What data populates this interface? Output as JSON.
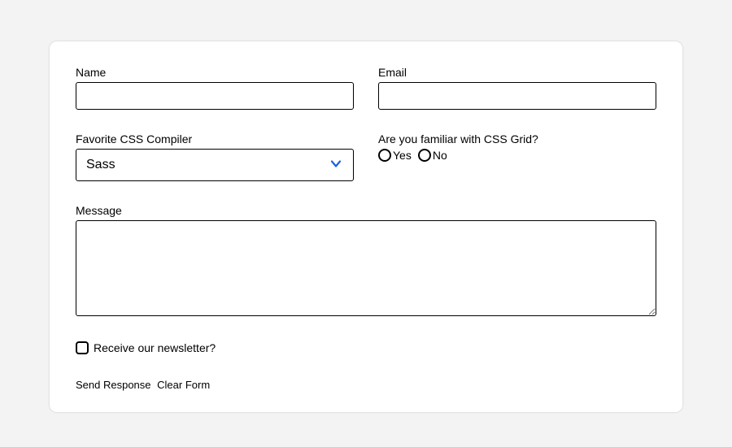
{
  "form": {
    "name": {
      "label": "Name",
      "value": ""
    },
    "email": {
      "label": "Email",
      "value": ""
    },
    "compiler": {
      "label": "Favorite CSS Compiler",
      "selected": "Sass"
    },
    "grid": {
      "label": "Are you familiar with CSS Grid?",
      "options": {
        "yes": "Yes",
        "no": "No"
      }
    },
    "message": {
      "label": "Message",
      "value": ""
    },
    "newsletter": {
      "label": "Receive our newsletter?"
    },
    "actions": {
      "submit": "Send Response",
      "clear": "Clear Form"
    }
  },
  "colors": {
    "accent": "#1a63d9"
  }
}
